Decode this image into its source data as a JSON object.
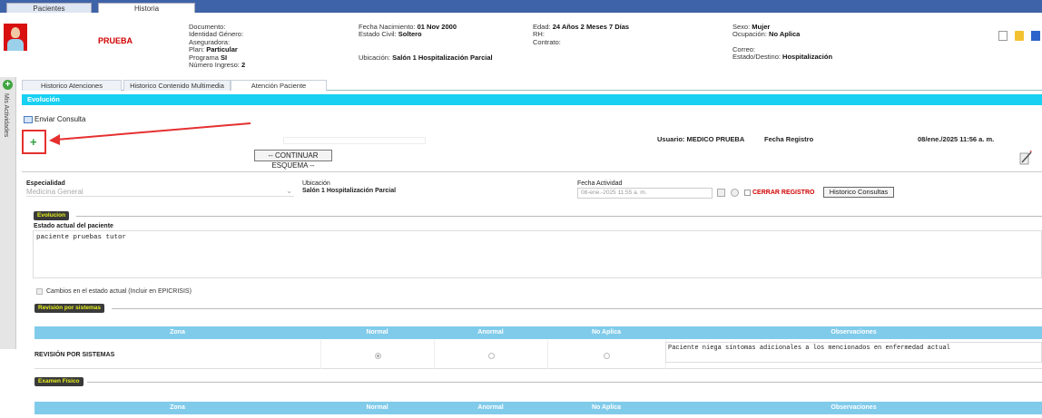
{
  "top_tabs": [
    "Pacientes",
    "Historia"
  ],
  "patient": {
    "name": "PRUEBA",
    "col1": [
      {
        "label": "Documento:",
        "value": ""
      },
      {
        "label": "Identidad Género:",
        "value": ""
      },
      {
        "label": "Aseguradora:",
        "value": ""
      },
      {
        "label": "Plan:",
        "value": "Particular"
      },
      {
        "label": "Programa",
        "value": "SI"
      },
      {
        "label": "Número Ingreso:",
        "value": "2"
      }
    ],
    "col2": [
      {
        "label": "Fecha Nacimiento:",
        "value": "01 Nov 2000"
      },
      {
        "label": "Estado Civil:",
        "value": "Soltero"
      }
    ],
    "col2_ubicacion": {
      "label": "Ubicación:",
      "value": "Salón 1 Hospitalización Parcial"
    },
    "col3": [
      {
        "label": "Edad:",
        "value": "24 Años 2 Meses 7 Días"
      },
      {
        "label": "RH:",
        "value": ""
      },
      {
        "label": "Contrato:",
        "value": ""
      }
    ],
    "col4": [
      {
        "label": "Sexo:",
        "value": "Mujer"
      },
      {
        "label": "Ocupación:",
        "value": "No Aplica"
      }
    ],
    "col4_lower": [
      {
        "label": "Correo:",
        "value": ""
      },
      {
        "label": "Estado/Destino:",
        "value": "Hospitalización"
      }
    ]
  },
  "header_icons": [
    "new-document-icon",
    "folder-icon",
    "save-icon"
  ],
  "side_panel": {
    "label": "Mis Actividades"
  },
  "sub_tabs": [
    "Historico Atenciones",
    "Historico Contenido Multimedia",
    "Atención Paciente"
  ],
  "section_title": "Evolución",
  "enviar_consulta": "Enviar Consulta",
  "add_symbol": "+",
  "usuario": "Usuario: MEDICO PRUEBA",
  "fecha_registro_label": "Fecha Registro",
  "fecha_registro_value": "08/ene./2025 11:56 a. m.",
  "continuar_btn": "-- CONTINUAR ESQUEMA --",
  "form": {
    "especialidad_label": "Especialidad",
    "especialidad_value": "Medicina General",
    "ubicacion_label": "Ubicación",
    "ubicacion_value": "Salón 1 Hospitalización Parcial",
    "fecha_actividad_label": "Fecha Actividad",
    "fecha_actividad_value": "08-ene.-2025 11:55 a. m.",
    "cerrar_registro": "CERRAR REGISTRO",
    "historico_consultas": "Historico Consultas"
  },
  "evolucion": {
    "pill": "Evolucion",
    "estado_label": "Estado actual del paciente",
    "estado_text": "paciente pruebas tutor",
    "cambios_label": "Cambios en el estado actual (Incluir en EPICRISIS)"
  },
  "revision": {
    "pill": "Revisión por sistemas",
    "columns": [
      "Zona",
      "Normal",
      "Anormal",
      "No Aplica",
      "Observaciones"
    ],
    "row_zona": "REVISIÓN POR SISTEMAS",
    "row_obs": "Paciente niega síntomas adicionales a los mencionados en enfermedad actual"
  },
  "examen": {
    "pill": "Examen Físico",
    "columns": [
      "Zona",
      "Normal",
      "Anormal",
      "No Aplica",
      "Observaciones"
    ]
  },
  "colors": {
    "accent": "#18d0f2",
    "header_bar": "#3f63a8",
    "grid_header": "#81cbea",
    "alert": "#d10000",
    "highlight_box": "#e53030"
  }
}
